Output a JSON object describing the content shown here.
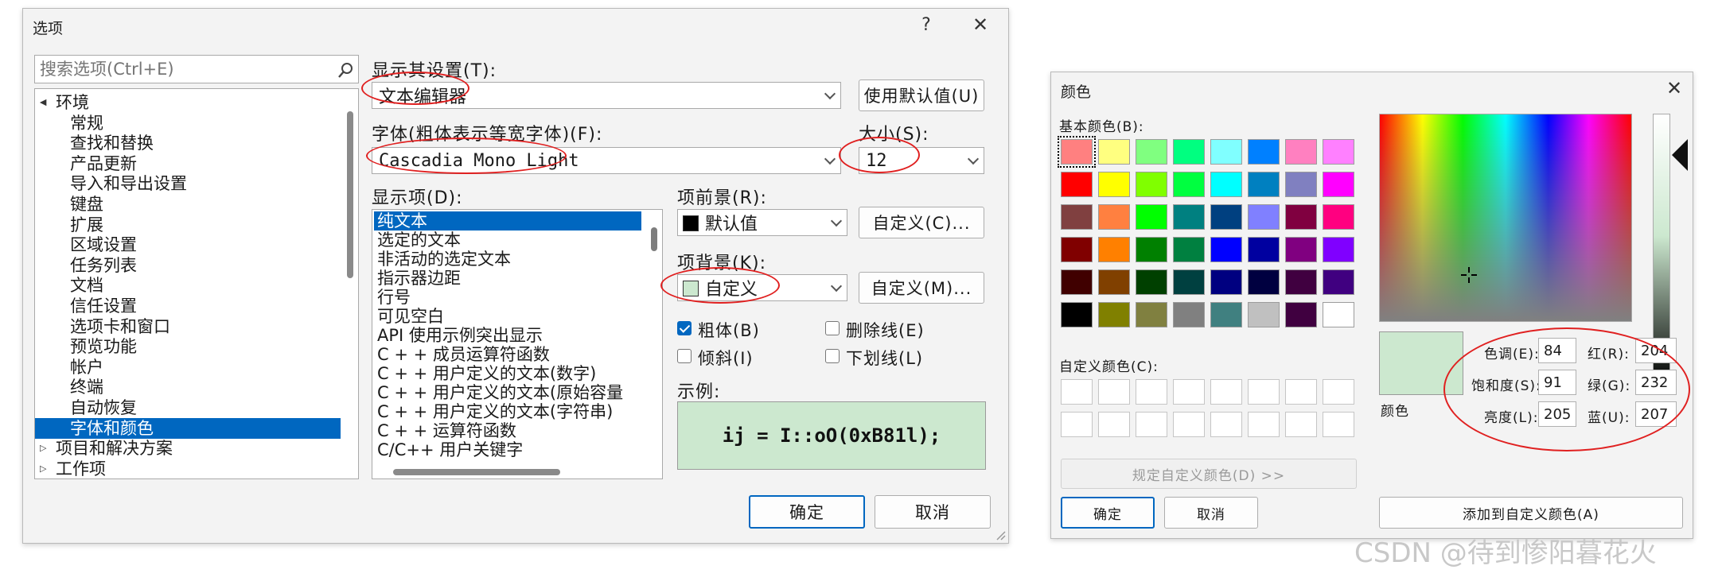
{
  "options": {
    "title": "选项",
    "help": "?",
    "close": "✕",
    "search_placeholder": "搜索选项(Ctrl+E)",
    "tree": [
      {
        "label": "环境",
        "level": 0,
        "expanded": true
      },
      {
        "label": "常规",
        "level": 1
      },
      {
        "label": "查找和替换",
        "level": 1
      },
      {
        "label": "产品更新",
        "level": 1
      },
      {
        "label": "导入和导出设置",
        "level": 1
      },
      {
        "label": "键盘",
        "level": 1
      },
      {
        "label": "扩展",
        "level": 1
      },
      {
        "label": "区域设置",
        "level": 1
      },
      {
        "label": "任务列表",
        "level": 1
      },
      {
        "label": "文档",
        "level": 1
      },
      {
        "label": "信任设置",
        "level": 1
      },
      {
        "label": "选项卡和窗口",
        "level": 1
      },
      {
        "label": "预览功能",
        "level": 1
      },
      {
        "label": "帐户",
        "level": 1
      },
      {
        "label": "终端",
        "level": 1
      },
      {
        "label": "自动恢复",
        "level": 1
      },
      {
        "label": "字体和颜色",
        "level": 1,
        "selected": true
      },
      {
        "label": "项目和解决方案",
        "level": 0,
        "expanded": false
      },
      {
        "label": "工作项",
        "level": 0,
        "expanded": false
      }
    ],
    "show_settings_label": "显示其设置(T):",
    "show_settings_value": "文本编辑器",
    "use_default_button": "使用默认值(U)",
    "font_label": "字体(粗体表示等宽字体)(F):",
    "font_value": "Cascadia Mono Light",
    "size_label": "大小(S):",
    "size_value": "12",
    "display_items_label": "显示项(D):",
    "display_items": [
      {
        "label": "纯文本",
        "selected": true
      },
      {
        "label": "选定的文本"
      },
      {
        "label": "非活动的选定文本"
      },
      {
        "label": "指示器边距"
      },
      {
        "label": "行号"
      },
      {
        "label": "可见空白"
      },
      {
        "label": "API 使用示例突出显示"
      },
      {
        "label": "C + + 成员运算符函数"
      },
      {
        "label": "C + + 用户定义的文本(数字)"
      },
      {
        "label": "C + + 用户定义的文本(原始容量"
      },
      {
        "label": "C + + 用户定义的文本(字符串)"
      },
      {
        "label": "C + + 运算符函数"
      },
      {
        "label": "C/C++ 用户关键字"
      }
    ],
    "fg_label": "项前景(R):",
    "fg_value": "默认值",
    "fg_swatch": "#000000",
    "custom_c_button": "自定义(C)...",
    "bg_label": "项背景(K):",
    "bg_value": "自定义",
    "bg_swatch": "#cce8cf",
    "custom_m_button": "自定义(M)...",
    "bold_label": "粗体(B)",
    "bold_checked": true,
    "strike_label": "删除线(E)",
    "strike_checked": false,
    "italic_label": "倾斜(I)",
    "italic_checked": false,
    "underline_label": "下划线(L)",
    "underline_checked": false,
    "sample_label": "示例:",
    "sample_text": "ij = I::oO(0xB81l);",
    "ok_button": "确定",
    "cancel_button": "取消"
  },
  "color_dialog": {
    "title": "颜色",
    "close": "✕",
    "basic_label": "基本颜色(B):",
    "basic_colors": [
      "#ff8080",
      "#ffff80",
      "#80ff80",
      "#00ff80",
      "#80ffff",
      "#0080ff",
      "#ff80c0",
      "#ff80ff",
      "#ff0000",
      "#ffff00",
      "#80ff00",
      "#00ff40",
      "#00ffff",
      "#0080c0",
      "#8080c0",
      "#ff00ff",
      "#804040",
      "#ff8040",
      "#00ff00",
      "#008080",
      "#004080",
      "#8080ff",
      "#800040",
      "#ff0080",
      "#800000",
      "#ff8000",
      "#008000",
      "#008040",
      "#0000ff",
      "#0000a0",
      "#800080",
      "#8000ff",
      "#400000",
      "#804000",
      "#004000",
      "#004040",
      "#000080",
      "#000040",
      "#400040",
      "#400080",
      "#000000",
      "#808000",
      "#808040",
      "#808080",
      "#408080",
      "#c0c0c0",
      "#400040",
      "#ffffff"
    ],
    "selected_basic_index": 0,
    "custom_label": "自定义颜色(C):",
    "custom_colors": [
      "#ffffff",
      "#ffffff",
      "#ffffff",
      "#ffffff",
      "#ffffff",
      "#ffffff",
      "#ffffff",
      "#ffffff",
      "#ffffff",
      "#ffffff",
      "#ffffff",
      "#ffffff",
      "#ffffff",
      "#ffffff",
      "#ffffff",
      "#ffffff"
    ],
    "define_custom_button": "规定自定义颜色(D) >>",
    "ok_button": "确定",
    "cancel_button": "取消",
    "preview_label": "颜色",
    "preview_color": "#cce8cf",
    "hue_label": "色调(E):",
    "hue_value": "84",
    "sat_label": "饱和度(S):",
    "sat_value": "91",
    "lum_label": "亮度(L):",
    "lum_value": "205",
    "red_label": "红(R):",
    "red_value": "204",
    "green_label": "绿(G):",
    "green_value": "232",
    "blue_label": "蓝(U):",
    "blue_value": "207",
    "add_custom_button": "添加到自定义颜色(A)"
  },
  "annotations": {
    "circles": [
      {
        "target": "show-settings-combo"
      },
      {
        "target": "font-combo"
      },
      {
        "target": "size-combo"
      },
      {
        "target": "bg-combo"
      },
      {
        "target": "hsl-rgb-fields"
      }
    ]
  },
  "watermark": "CSDN @待到惨阳暮花火"
}
